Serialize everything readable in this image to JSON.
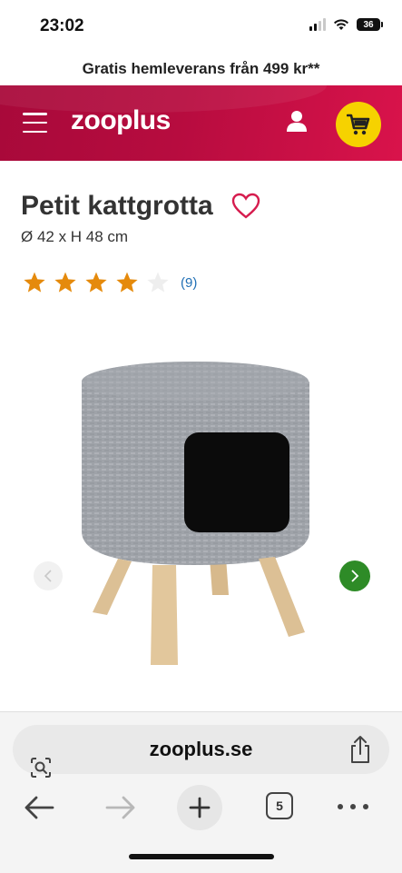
{
  "status_bar": {
    "time": "23:02",
    "battery": "36"
  },
  "promo": {
    "text": "Gratis hemleverans från 499 kr**"
  },
  "header": {
    "logo": "zooplus",
    "brand_color": "#b70c3f",
    "cart_color": "#f6d200"
  },
  "product": {
    "title": "Petit kattgrotta",
    "dimensions": "Ø 42 x H 48 cm",
    "rating": 4,
    "rating_max": 5,
    "review_count": "(9)",
    "star_color": "#e58a0c"
  },
  "browser": {
    "url": "zooplus.se",
    "tab_count": "5"
  },
  "icons": [
    "menu-icon",
    "user-icon",
    "cart-icon",
    "heart-icon",
    "star-icon",
    "chevron-left-icon",
    "chevron-right-icon",
    "lens-icon",
    "share-icon",
    "back-arrow-icon",
    "forward-arrow-icon",
    "plus-icon",
    "more-icon"
  ]
}
